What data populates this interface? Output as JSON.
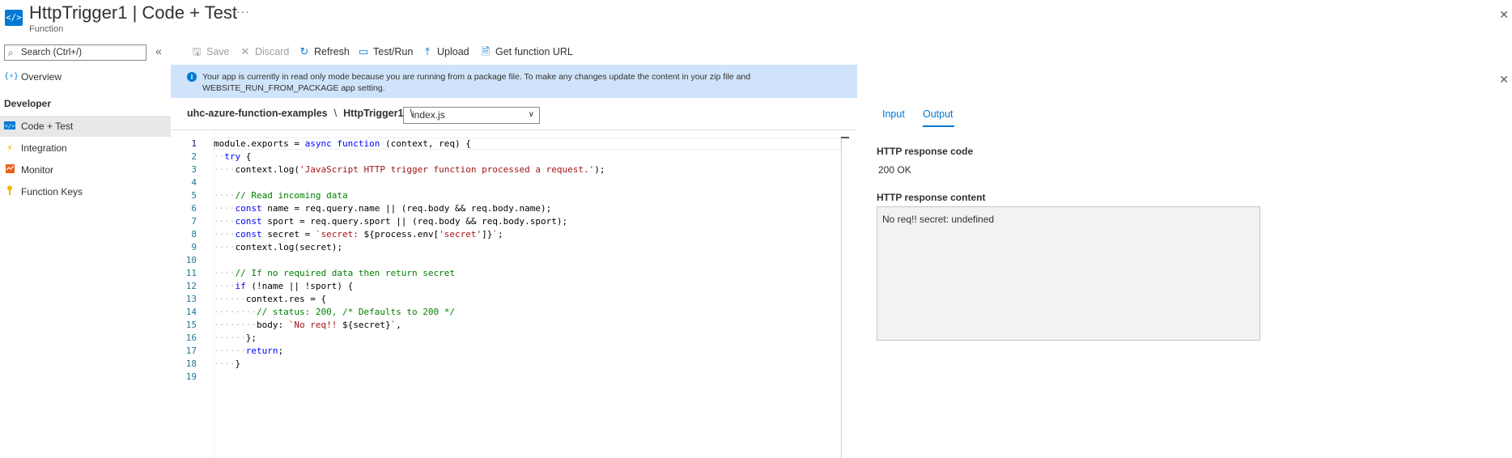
{
  "header": {
    "title": "HttpTrigger1",
    "title_suffix": "| Code + Test",
    "subtitle": "Function",
    "more": "···",
    "close": "✕"
  },
  "nav": {
    "search_placeholder": "Search (Ctrl+/)",
    "collapse": "«",
    "overview": "Overview",
    "section": "Developer",
    "items": [
      {
        "label": "Code + Test",
        "icon": "code-icon",
        "active": true
      },
      {
        "label": "Integration",
        "icon": "lightning-icon"
      },
      {
        "label": "Monitor",
        "icon": "monitor-icon"
      },
      {
        "label": "Function Keys",
        "icon": "key-icon"
      }
    ]
  },
  "toolbar": {
    "save": "Save",
    "discard": "Discard",
    "refresh": "Refresh",
    "test_run": "Test/Run",
    "upload": "Upload",
    "get_url": "Get function URL"
  },
  "banner": {
    "message": "Your app is currently in read only mode because you are running from a package file. To make any changes update the content in your zip file and WEBSITE_RUN_FROM_PACKAGE app setting."
  },
  "path": {
    "app": "uhc-azure-function-examples",
    "function": "HttpTrigger1",
    "file": "index.js",
    "sep": "\\"
  },
  "editor": {
    "line_numbers": [
      "1",
      "2",
      "3",
      "4",
      "5",
      "6",
      "7",
      "8",
      "9",
      "10",
      "11",
      "12",
      "13",
      "14",
      "15",
      "16",
      "17",
      "18",
      "19"
    ]
  },
  "panel": {
    "tab_input": "Input",
    "tab_output": "Output",
    "response_code_label": "HTTP response code",
    "response_code": "200 OK",
    "response_content_label": "HTTP response content",
    "response_content": "No req!! secret: undefined",
    "close": "✕"
  },
  "colors": {
    "accent": "#0078d4",
    "banner": "#cfe4fa",
    "keyword": "#0000ff",
    "string": "#a31515",
    "comment": "#008000"
  }
}
